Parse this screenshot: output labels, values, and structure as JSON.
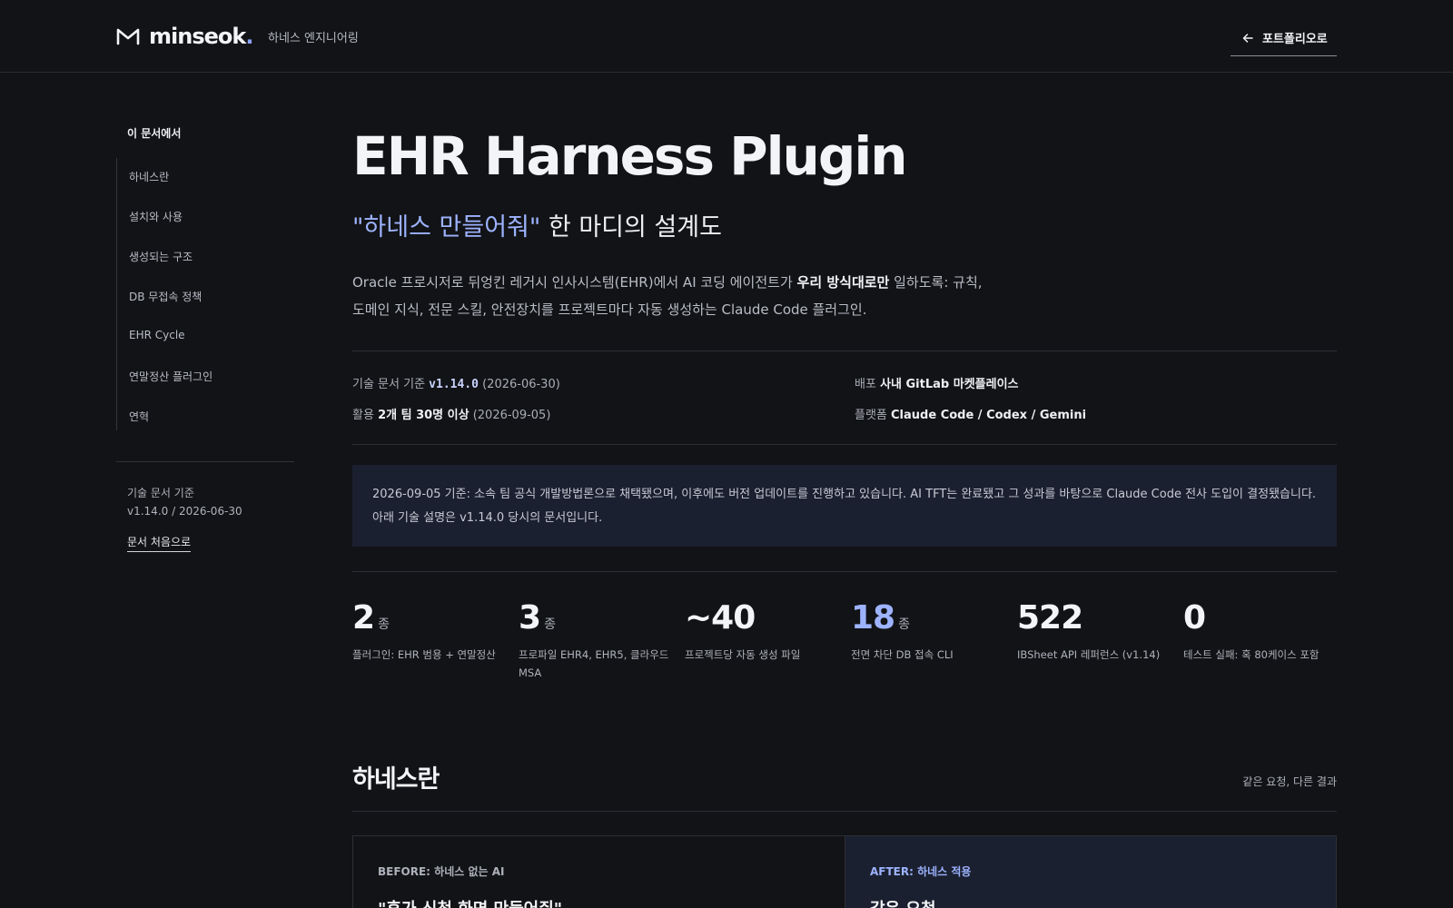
{
  "header": {
    "brand": "minseok",
    "brand_dot": ".",
    "subtitle": "하네스 엔지니어링",
    "back_label": "포트폴리오로"
  },
  "sidebar": {
    "title": "이 문서에서",
    "items": [
      {
        "label": "하네스란"
      },
      {
        "label": "설치와 사용"
      },
      {
        "label": "생성되는 구조"
      },
      {
        "label": "DB 무접속 정책"
      },
      {
        "label": "EHR Cycle"
      },
      {
        "label": "연말정산 플러그인"
      },
      {
        "label": "연혁"
      }
    ],
    "meta_label": "기술 문서 기준",
    "meta_value": "v1.14.0 / 2026-06-30",
    "top_link": "문서 처음으로"
  },
  "main": {
    "title": "EHR Harness Plugin",
    "subtitle_quote": "\"하네스 만들어줘\"",
    "subtitle_rest": " 한 마디의 설계도",
    "desc_1": "Oracle 프로시저로 뒤엉킨 레거시 인사시스템(EHR)에서 AI 코딩 에이전트가 ",
    "desc_bold": "우리 방식대로만",
    "desc_2": " 일하도록: 규칙, 도메인 지식, 전문 스킬, 안전장치를 프로젝트마다 자동 생성하는 Claude Code 플러그인.",
    "meta": {
      "doc_label": "기술 문서 기준 ",
      "doc_version": "v1.14.0",
      "doc_date": " (2026-06-30)",
      "deploy_label": "배포 ",
      "deploy_value": "사내 GitLab 마켓플레이스",
      "usage_label": "활용 ",
      "usage_value": "2개 팀 30명 이상",
      "usage_date": " (2026-09-05)",
      "platform_label": "플랫폼 ",
      "platform_value": "Claude Code / Codex / Gemini"
    },
    "notice_1": "2026-09-05 기준: 소속 팀 공식 개발방법론으로 채택됐으며, 이후에도 버전 업데이트를 진행하고 있습니다. AI TFT는 완료됐고 그 성과를 바탕으로 Claude Code 전사 도입이 결정됐습니다.",
    "notice_2": "아래 기술 설명은 v1.14.0 당시의 문서입니다.",
    "stats": [
      {
        "value": "2",
        "unit": "종",
        "label": "플러그인: EHR 범용 + 연말정산"
      },
      {
        "value": "3",
        "unit": "종",
        "label": "프로파일 EHR4, EHR5, 클라우드 MSA"
      },
      {
        "value": "~40",
        "unit": "",
        "label": "프로젝트당 자동 생성 파일"
      },
      {
        "value": "18",
        "unit": "종",
        "label": "전면 차단 DB 접속 CLI"
      },
      {
        "value": "522",
        "unit": "",
        "label": "IBSheet API 레퍼런스 (v1.14)"
      },
      {
        "value": "0",
        "unit": "",
        "label": "테스트 실패: 혹 80케이스 포함"
      }
    ],
    "section_title": "하네스란",
    "section_aside": "같은 요청, 다른 결과",
    "before_label": "BEFORE: 하네스 없는 AI",
    "before_quote": "\"휴가 신청 화면 만들어줘\"",
    "after_label": "AFTER: 하네스 적용",
    "after_quote": "같은 요청"
  },
  "colors": {
    "background": "#121316",
    "accent": "#9db3ff",
    "panel": "#1b2030"
  }
}
